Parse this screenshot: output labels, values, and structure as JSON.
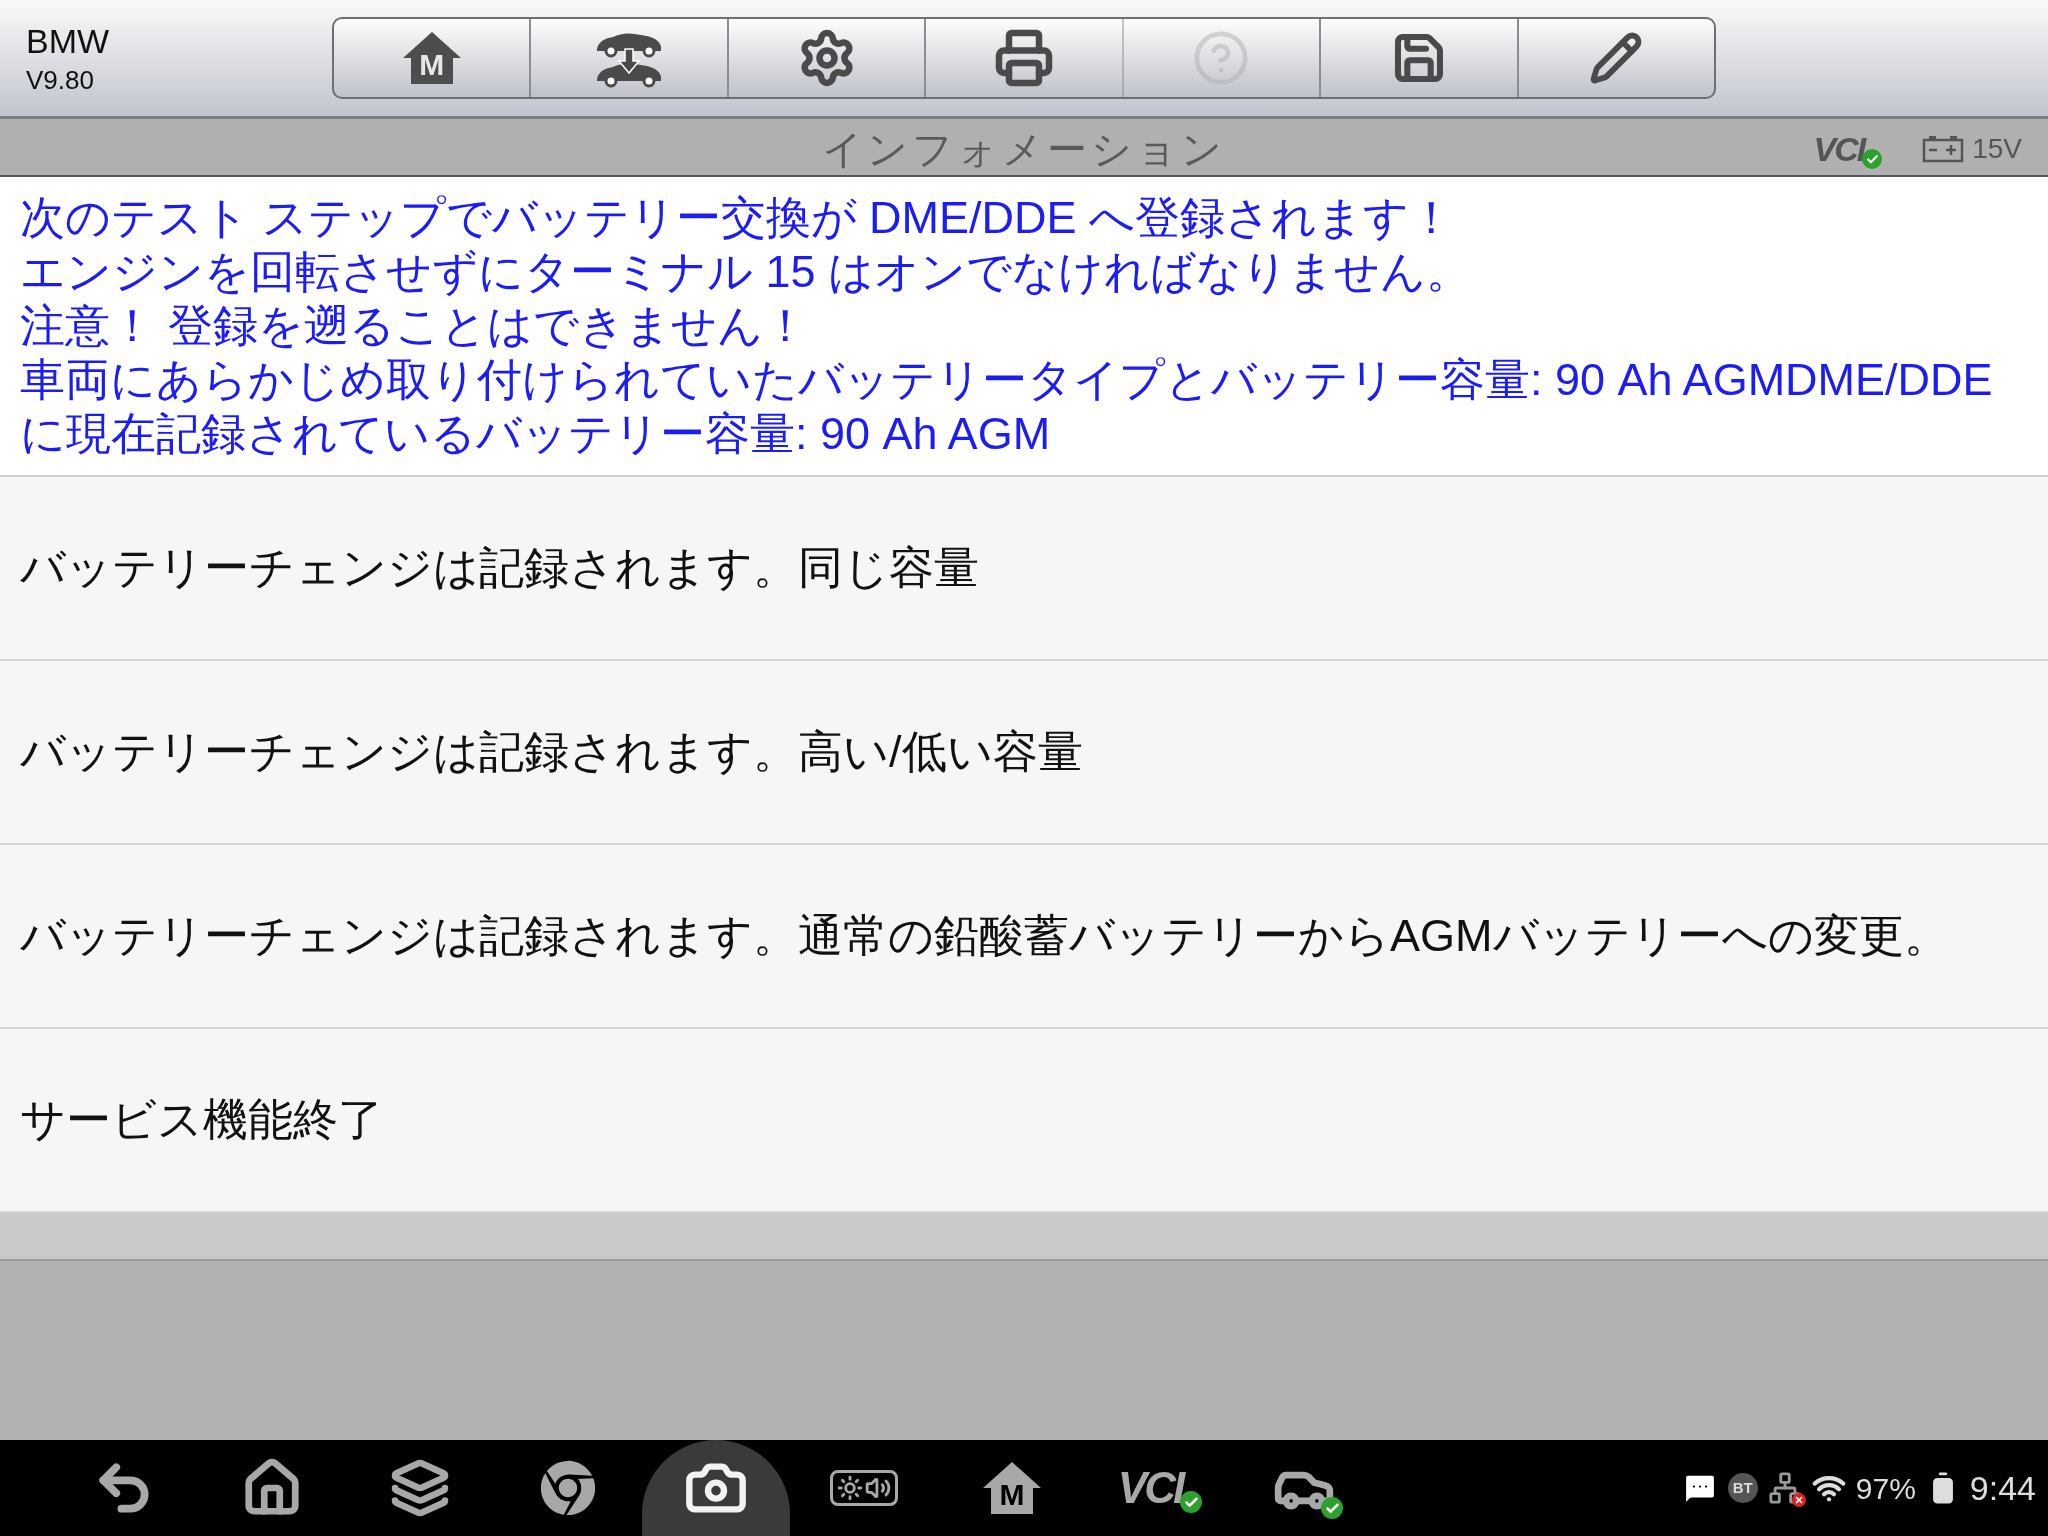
{
  "app": {
    "name": "BMW",
    "version": "V9.80"
  },
  "toolbar": [
    {
      "kind": "home",
      "label": "M",
      "disabled": false
    },
    {
      "kind": "vehicle-swap",
      "disabled": false
    },
    {
      "kind": "settings",
      "disabled": false
    },
    {
      "kind": "print",
      "disabled": false
    },
    {
      "kind": "help",
      "disabled": true
    },
    {
      "kind": "save",
      "disabled": false
    },
    {
      "kind": "edit",
      "disabled": false
    }
  ],
  "title_bar": {
    "title": "インフォメーション",
    "vci_label": "VCI",
    "vci_connected": true,
    "battery_voltage": "15V"
  },
  "info_lines": [
    "次のテスト ステップでバッテリー交換が DME/DDE へ登録されます！",
    "エンジンを回転させずにターミナル 15 はオンでなければなりません。",
    "注意！ 登録を遡ることはできません！",
    "車両にあらかじめ取り付けられていたバッテリータイプとバッテリー容量: 90 Ah AGMDME/DDE",
    "に現在記録されているバッテリー容量: 90 Ah AGM"
  ],
  "menu_items": [
    "バッテリーチェンジは記録されます。同じ容量",
    "バッテリーチェンジは記録されます。高い/低い容量",
    "バッテリーチェンジは記録されます。通常の鉛酸蓄バッテリーからAGMバッテリーへの変更。",
    "サービス機能終了"
  ],
  "taskbar": [
    {
      "kind": "back",
      "selected": false
    },
    {
      "kind": "home",
      "selected": false
    },
    {
      "kind": "recents",
      "selected": false
    },
    {
      "kind": "browser",
      "selected": false
    },
    {
      "kind": "camera",
      "selected": true
    },
    {
      "kind": "brightness-volume",
      "selected": false
    },
    {
      "kind": "maxisys-home",
      "label": "M",
      "selected": false
    },
    {
      "kind": "vci",
      "label": "VCI",
      "selected": false
    },
    {
      "kind": "vehicle",
      "selected": false
    }
  ],
  "status_bar": {
    "bluetooth_label": "BT",
    "battery": "97%",
    "time": "9:44"
  }
}
